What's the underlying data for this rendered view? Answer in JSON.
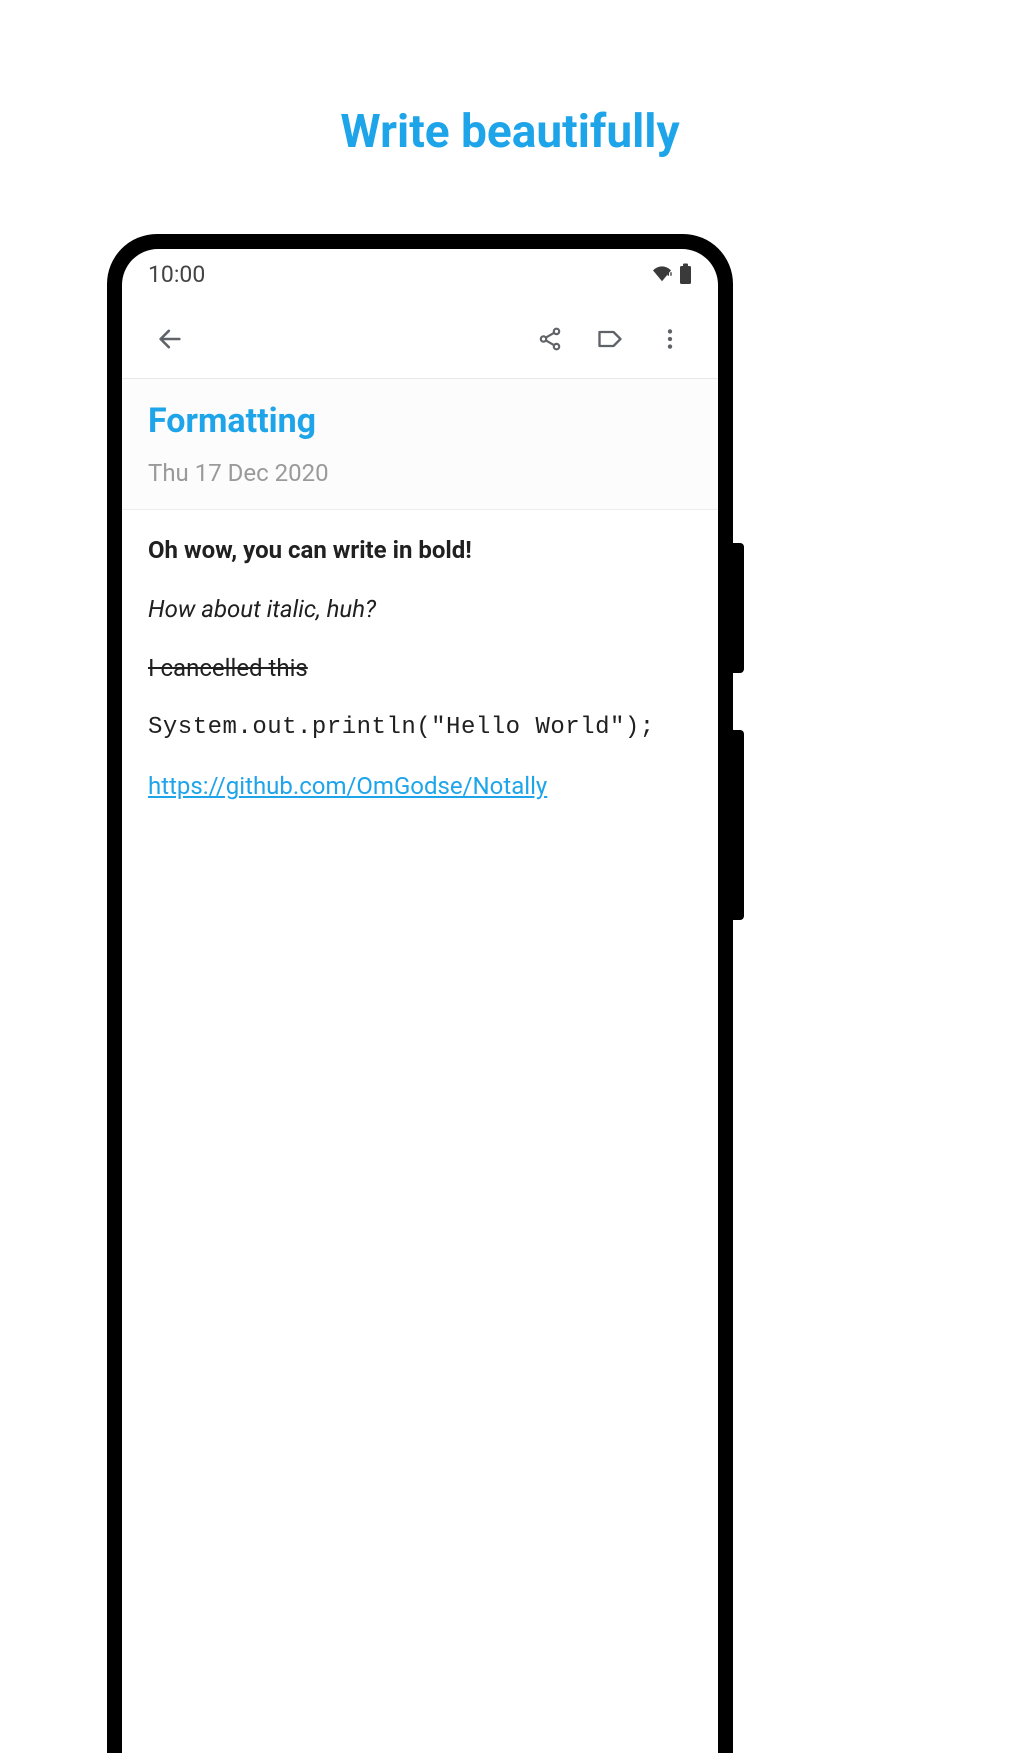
{
  "header": {
    "tagline": "Write beautifully"
  },
  "status_bar": {
    "time": "10:00"
  },
  "note": {
    "title": "Formatting",
    "date": "Thu 17 Dec 2020",
    "body": {
      "bold_line": "Oh wow, you can write in bold!",
      "italic_line": "How about italic, huh?",
      "strike_line": "I cancelled this",
      "code_line": "System.out.println(\"Hello World\");",
      "link_text": "https://github.com/OmGodse/Notally"
    }
  }
}
